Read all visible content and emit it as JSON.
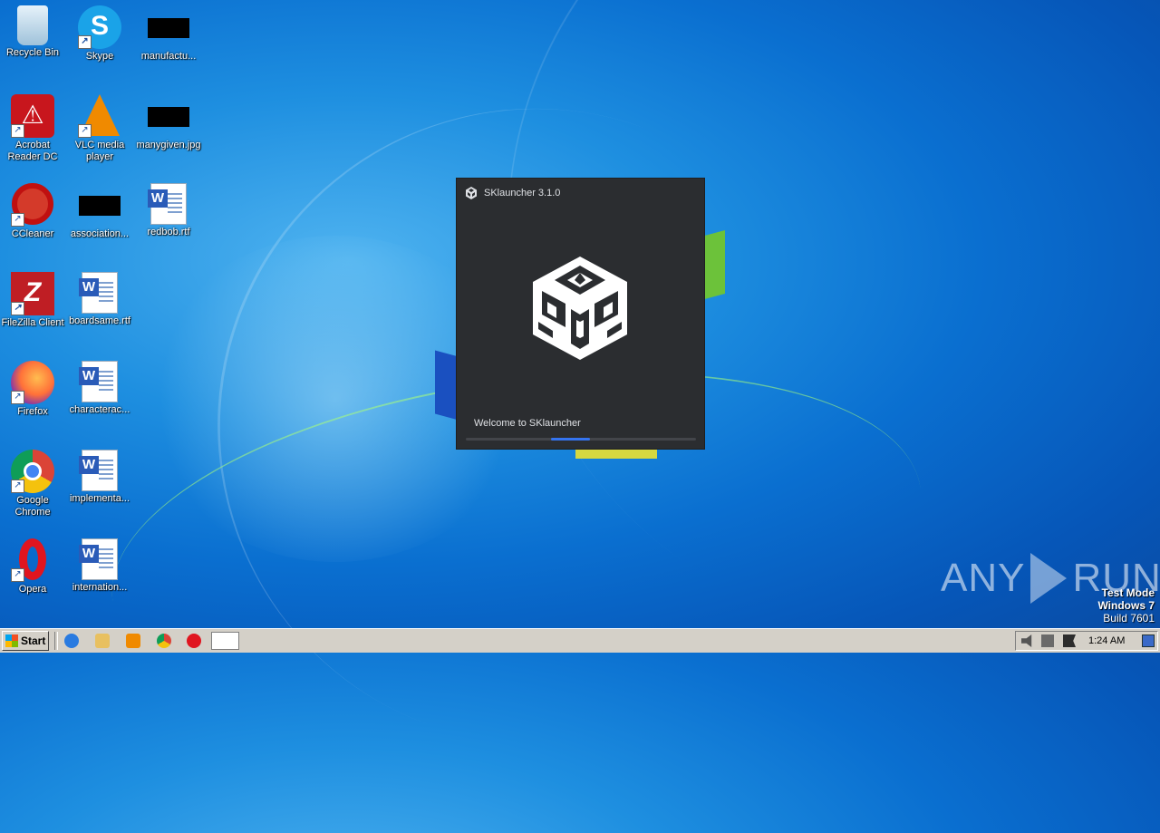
{
  "desktop": {
    "icons": [
      {
        "label": "Recycle Bin"
      },
      {
        "label": "Skype"
      },
      {
        "label": "manufactu..."
      },
      {
        "label": "Acrobat Reader DC"
      },
      {
        "label": "VLC media player"
      },
      {
        "label": "manygiven.jpg"
      },
      {
        "label": "CCleaner"
      },
      {
        "label": "association..."
      },
      {
        "label": "redbob.rtf"
      },
      {
        "label": "FileZilla Client"
      },
      {
        "label": "boardsame.rtf"
      },
      {
        "label": "Firefox"
      },
      {
        "label": "characterac..."
      },
      {
        "label": "Google Chrome"
      },
      {
        "label": "implementa..."
      },
      {
        "label": "Opera"
      },
      {
        "label": "internation..."
      }
    ]
  },
  "splash": {
    "title": "SKlauncher 3.1.0",
    "status": "Welcome to SKlauncher",
    "progress_fraction": 0.17,
    "accent_color": "#3574f0",
    "background_color": "#2b2d30"
  },
  "watermark": {
    "brand_left": "ANY",
    "brand_right": "RUN",
    "mode": "Test Mode",
    "os": "Windows 7",
    "build": "Build 7601"
  },
  "taskbar": {
    "start_label": "Start",
    "pinned": [
      "ie-icon",
      "explorer-icon",
      "media-player-icon",
      "chrome-icon",
      "opera-icon"
    ],
    "clock": "1:24 AM"
  }
}
